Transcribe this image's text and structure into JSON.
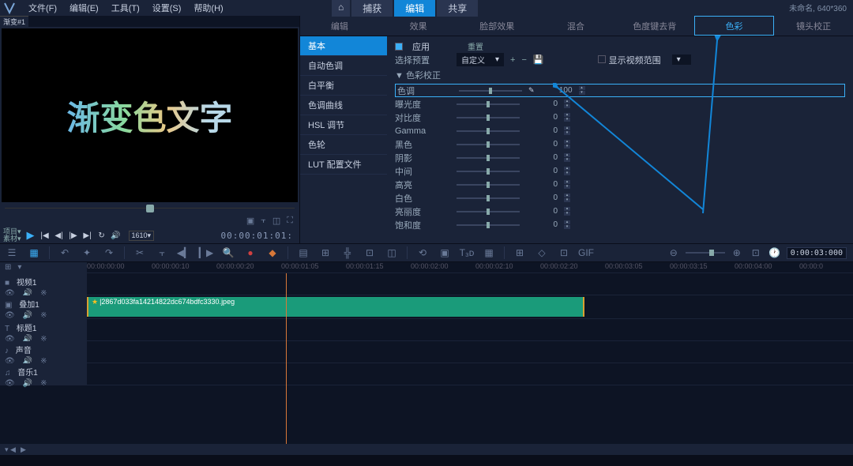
{
  "menu": {
    "file": "文件(F)",
    "edit": "编辑(E)",
    "tools": "工具(T)",
    "settings": "设置(S)",
    "help": "帮助(H)"
  },
  "mainTabs": {
    "capture": "捕获",
    "edit": "编辑",
    "share": "共享"
  },
  "docInfo": "未命名, 640*360",
  "preview": {
    "tab": "渐变#1",
    "text": "渐变色文字",
    "projectLabel": "项目▾\n素材▾",
    "fps": "1610▾",
    "time": "00:00:01:01:"
  },
  "effectsTabs": [
    "编辑",
    "效果",
    "脸部效果",
    "混合",
    "色度键去背",
    "色彩",
    "镜头校正"
  ],
  "effectsSidebar": [
    "基本",
    "自动色调",
    "白平衡",
    "色调曲线",
    "HSL 调节",
    "色轮",
    "LUT 配置文件"
  ],
  "effectsContent": {
    "apply": "应用",
    "reset": "重置",
    "selectPreset": "选择预置",
    "custom": "自定义",
    "showRange": "显示视频范围",
    "section": "色彩校正",
    "params": [
      {
        "label": "色调",
        "value": "100",
        "highlight": true,
        "handle": 50
      },
      {
        "label": "曝光度",
        "value": "0",
        "handle": 50
      },
      {
        "label": "对比度",
        "value": "0",
        "handle": 50
      },
      {
        "label": "Gamma",
        "value": "0",
        "handle": 50
      },
      {
        "label": "黑色",
        "value": "0",
        "handle": 50
      },
      {
        "label": "阴影",
        "value": "0",
        "handle": 50
      },
      {
        "label": "中间",
        "value": "0",
        "handle": 50
      },
      {
        "label": "高亮",
        "value": "0",
        "handle": 50
      },
      {
        "label": "白色",
        "value": "0",
        "handle": 50
      },
      {
        "label": "亮丽度",
        "value": "0",
        "handle": 50
      },
      {
        "label": "饱和度",
        "value": "0",
        "handle": 50
      }
    ]
  },
  "toolbarTimecode": "0:00:03:000",
  "ruler": [
    "00:00:00:00",
    "00:00:00:10",
    "00:00:00:20",
    "00:00:01:05",
    "00:00:01:15",
    "00:00:02:00",
    "00:00:02:10",
    "00:00:02:20",
    "00:00:03:05",
    "00:00:03:15",
    "00:00:04:00",
    "00:00:0"
  ],
  "tracks": [
    {
      "type": "video",
      "label": "视频1"
    },
    {
      "type": "overlay",
      "label": "叠加1",
      "clip": "|2867d033fa14214822dc674bdfc3330.jpeg"
    },
    {
      "type": "title",
      "label": "标题1"
    },
    {
      "type": "audio",
      "label": "声音"
    },
    {
      "type": "music",
      "label": "音乐1"
    }
  ]
}
